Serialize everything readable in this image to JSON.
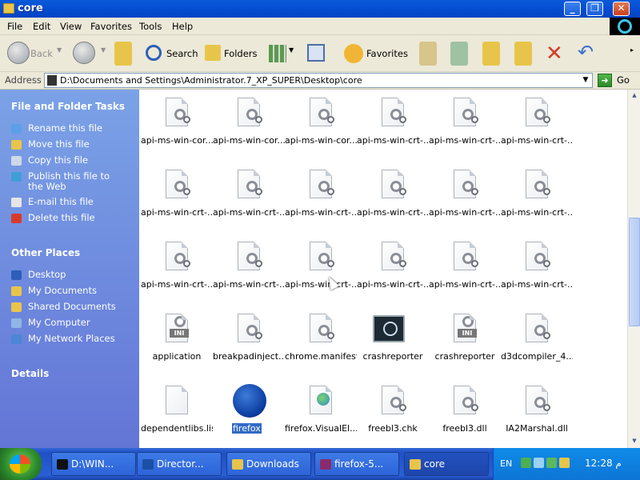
{
  "window": {
    "title": "core",
    "buttons": {
      "minimize": "_",
      "maximize": "❐",
      "close": "✕"
    }
  },
  "menu": [
    "File",
    "Edit",
    "View",
    "Favorites",
    "Tools",
    "Help"
  ],
  "toolbar": {
    "back": "Back",
    "search": "Search",
    "folders": "Folders",
    "favorites": "Favorites"
  },
  "address": {
    "label": "Address",
    "value": "D:\\Documents and Settings\\Administrator.7_XP_SUPER\\Desktop\\core",
    "go": "Go"
  },
  "leftpane": {
    "file_tasks_title": "File and Folder Tasks",
    "file_tasks": [
      {
        "label": "Rename this file",
        "icon": "rename-icon",
        "color": "#5aa0e6"
      },
      {
        "label": "Move this file",
        "icon": "move-icon",
        "color": "#e8c54a"
      },
      {
        "label": "Copy this file",
        "icon": "copy-icon",
        "color": "#cfd8e6"
      },
      {
        "label": "Publish this file to the Web",
        "icon": "publish-web-icon",
        "color": "#3f9ed6"
      },
      {
        "label": "E-mail this file",
        "icon": "email-icon",
        "color": "#e6e6e6"
      },
      {
        "label": "Delete this file",
        "icon": "delete-icon",
        "color": "#d63b2a"
      }
    ],
    "other_places_title": "Other Places",
    "other_places": [
      {
        "label": "Desktop",
        "icon": "desktop-icon",
        "color": "#2c5fb8"
      },
      {
        "label": "My Documents",
        "icon": "my-documents-icon",
        "color": "#e8c54a"
      },
      {
        "label": "Shared Documents",
        "icon": "shared-documents-icon",
        "color": "#e8c54a"
      },
      {
        "label": "My Computer",
        "icon": "my-computer-icon",
        "color": "#8fb6e6"
      },
      {
        "label": "My Network Places",
        "icon": "network-places-icon",
        "color": "#4c86d6"
      }
    ],
    "details_title": "Details"
  },
  "files": [
    {
      "name": "api-ms-win-cor...",
      "type": "gear"
    },
    {
      "name": "api-ms-win-cor...",
      "type": "gear"
    },
    {
      "name": "api-ms-win-cor...",
      "type": "gear"
    },
    {
      "name": "api-ms-win-crt-...",
      "type": "gear"
    },
    {
      "name": "api-ms-win-crt-...",
      "type": "gear"
    },
    {
      "name": "api-ms-win-crt-...",
      "type": "gear"
    },
    {
      "name": "api-ms-win-crt-...",
      "type": "gear"
    },
    {
      "name": "api-ms-win-crt-...",
      "type": "gear"
    },
    {
      "name": "api-ms-win-crt-...",
      "type": "gear"
    },
    {
      "name": "api-ms-win-crt-...",
      "type": "gear"
    },
    {
      "name": "api-ms-win-crt-...",
      "type": "gear"
    },
    {
      "name": "api-ms-win-crt-...",
      "type": "gear"
    },
    {
      "name": "api-ms-win-crt-...",
      "type": "gear"
    },
    {
      "name": "api-ms-win-crt-...",
      "type": "gear"
    },
    {
      "name": "api-ms-win-crt-...",
      "type": "gear"
    },
    {
      "name": "api-ms-win-crt-...",
      "type": "gear"
    },
    {
      "name": "api-ms-win-crt-...",
      "type": "gear"
    },
    {
      "name": "api-ms-win-crt-...",
      "type": "gear"
    },
    {
      "name": "application",
      "type": "ini"
    },
    {
      "name": "breakpadinject...",
      "type": "gear"
    },
    {
      "name": "chrome.manifest",
      "type": "gear"
    },
    {
      "name": "crashreporter",
      "type": "crash"
    },
    {
      "name": "crashreporter",
      "type": "ini"
    },
    {
      "name": "d3dcompiler_4...",
      "type": "gear"
    },
    {
      "name": "dependentlibs.list",
      "type": "blank"
    },
    {
      "name": "firefox",
      "type": "firefox",
      "selected": true
    },
    {
      "name": "firefox.VisualEl...",
      "type": "globe"
    },
    {
      "name": "freebl3.chk",
      "type": "gear"
    },
    {
      "name": "freebl3.dll",
      "type": "gear"
    },
    {
      "name": "IA2Marshal.dll",
      "type": "gear"
    }
  ],
  "taskbar": {
    "items": [
      {
        "label": "D:\\WIN...",
        "icon": "cmd-icon",
        "color": "#111"
      },
      {
        "label": "Director...",
        "icon": "directory-icon",
        "color": "#1b4fa8"
      },
      {
        "label": "Downloads",
        "icon": "folder-icon",
        "color": "#e8c54a"
      },
      {
        "label": "firefox-5...",
        "icon": "archive-icon",
        "color": "#8b2b6b"
      },
      {
        "label": "core",
        "icon": "folder-icon",
        "color": "#e8c54a",
        "active": true
      }
    ],
    "tray": {
      "lang": "EN",
      "clock": "12:28 م"
    }
  }
}
